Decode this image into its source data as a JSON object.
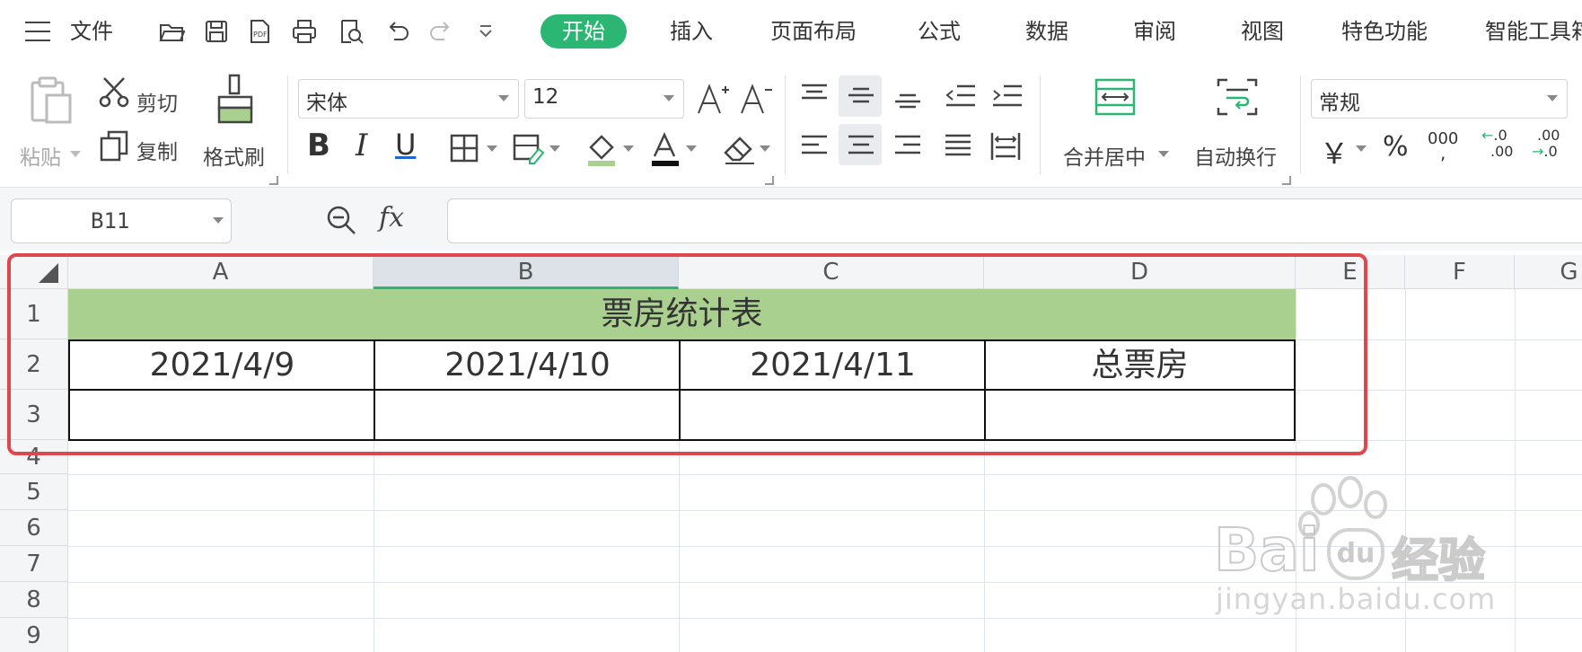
{
  "menu": {
    "file_label": "文件",
    "tabs": [
      {
        "label": "开始",
        "active": true
      },
      {
        "label": "插入"
      },
      {
        "label": "页面布局"
      },
      {
        "label": "公式"
      },
      {
        "label": "数据"
      },
      {
        "label": "审阅"
      },
      {
        "label": "视图"
      },
      {
        "label": "特色功能"
      },
      {
        "label": "智能工具箱"
      }
    ]
  },
  "ribbon": {
    "paste_label": "粘贴",
    "cut_label": "剪切",
    "copy_label": "复制",
    "format_painter_label": "格式刷",
    "font_name": "宋体",
    "font_size": "12",
    "merge_label": "合并居中",
    "wrap_label": "自动换行",
    "number_format": "常规",
    "currency_symbol": "￥",
    "percent_symbol": "%",
    "thousands_symbol": "000",
    "increase_decimal": ".00",
    "decrease_decimal": ".0"
  },
  "formula_bar": {
    "name_box": "B11",
    "fx_label": "fx",
    "formula": ""
  },
  "sheet": {
    "columns": [
      "A",
      "B",
      "C",
      "D",
      "E",
      "F",
      "G"
    ],
    "selected_column": "B",
    "rows": [
      "1",
      "2",
      "3",
      "4",
      "5",
      "6",
      "7",
      "8",
      "9"
    ],
    "title": "票房统计表",
    "headers": [
      "2021/4/9",
      "2021/4/10",
      "2021/4/11",
      "总票房"
    ],
    "title_fill_color": "#a9d08e",
    "highlight_box_color": "#e0474c"
  },
  "watermark": {
    "brand_left": "Bai",
    "brand_right": "经验",
    "url": "jingyan.baidu.com"
  },
  "colors": {
    "accent": "#2bb673"
  }
}
